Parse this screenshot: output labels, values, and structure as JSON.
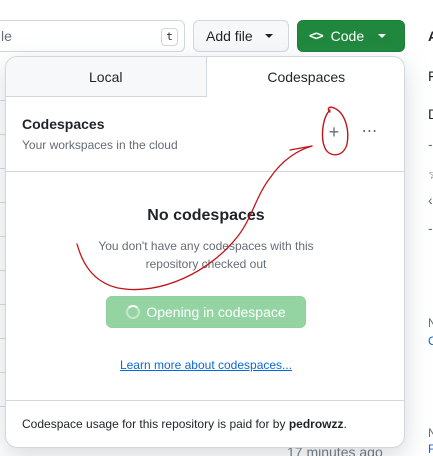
{
  "file_search": {
    "partial_text": "le",
    "shortcut_key": "t"
  },
  "toolbar": {
    "add_file_label": "Add file",
    "code_label": "Code",
    "code_icon_glyph": "<>"
  },
  "tabs": [
    {
      "label": "Local",
      "active": false
    },
    {
      "label": "Codespaces",
      "active": true
    }
  ],
  "codespaces": {
    "title": "Codespaces",
    "subtitle": "Your workspaces in the cloud",
    "add_icon": "plus-icon",
    "more_icon": "kebab-horizontal-icon",
    "empty_title": "No codespaces",
    "empty_text": "You don't have any codespaces with this repository checked out",
    "open_button_label": "Opening in codespace",
    "learn_more_label": "Learn more about codespaces...",
    "footer_prefix": "Codespace usage for this repository is paid for by",
    "footer_user": "pedrowzz",
    "footer_suffix": "."
  },
  "background": {
    "timestamp_peek": "17 minutes ago",
    "right_peeks": [
      "A",
      "F",
      "D",
      "-",
      "☆",
      "‹",
      "-",
      "N",
      "C",
      "N",
      "F"
    ]
  },
  "colors": {
    "primary_green": "#1f883d",
    "disabled_green": "#94d3a2",
    "link_blue": "#0969da",
    "annotation_red": "#c0141b"
  }
}
